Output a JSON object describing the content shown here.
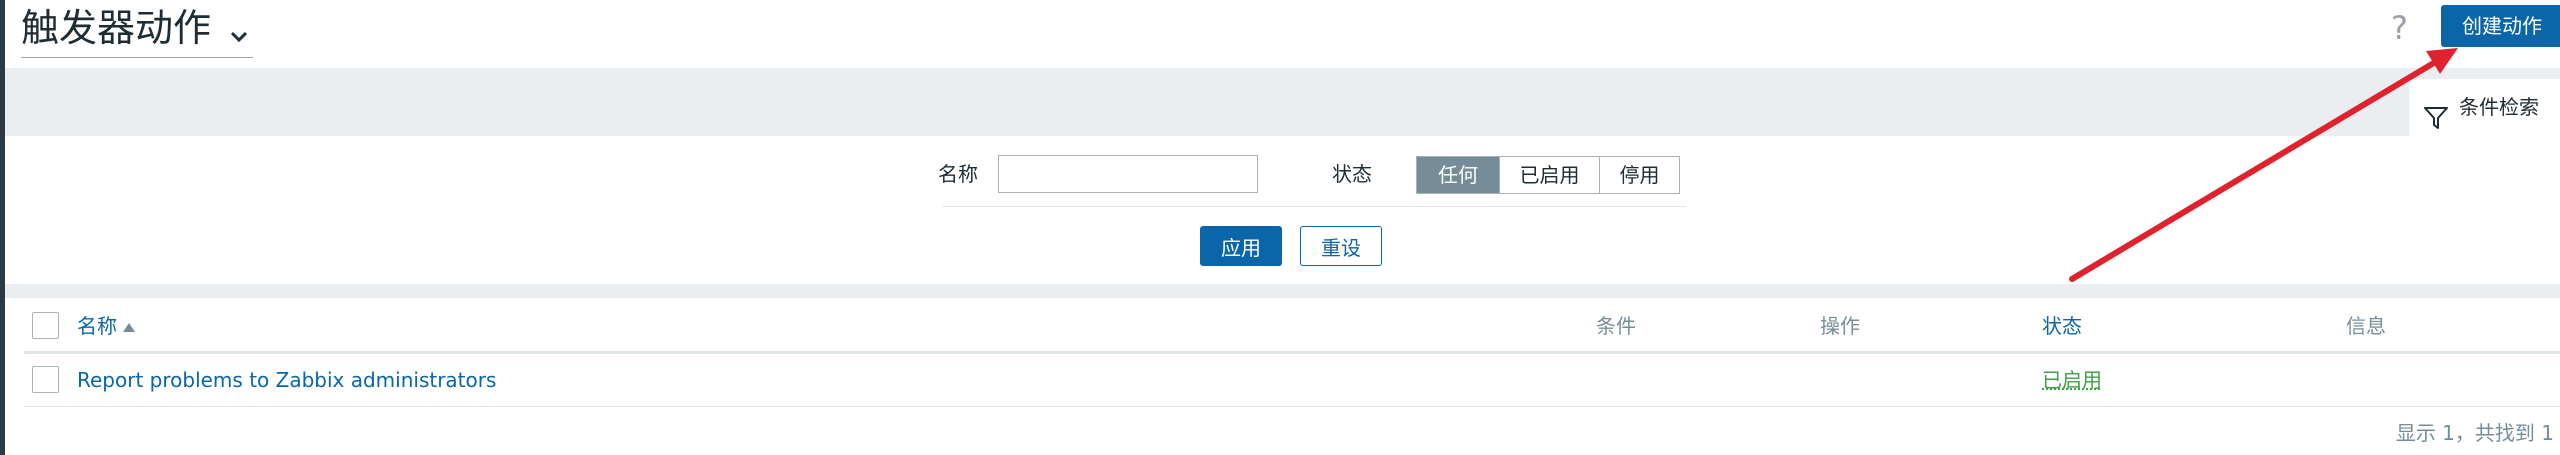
{
  "header": {
    "title": "触发器动作",
    "help_glyph": "?",
    "create_button": "创建动作"
  },
  "filter": {
    "tab_label": "条件检索",
    "name_label": "名称",
    "name_value": "",
    "status_label": "状态",
    "status_options": [
      "任何",
      "已启用",
      "停用"
    ],
    "status_selected": "任何",
    "apply_label": "应用",
    "reset_label": "重设"
  },
  "table": {
    "columns": [
      "名称",
      "条件",
      "操作",
      "状态",
      "信息"
    ],
    "sort_column": "名称",
    "rows": [
      {
        "name": "Report problems to Zabbix administrators",
        "conditions": "",
        "operations": "",
        "status": "已启用",
        "info": ""
      }
    ],
    "footer": "显示 1，共找到 1"
  },
  "colors": {
    "primary": "#0a66a8",
    "status_enabled": "#429e47",
    "annotation_arrow": "#e0212e",
    "segment_active": "#768d99"
  },
  "icons": [
    "chevron-down-icon",
    "help-icon",
    "filter-funnel-icon",
    "sort-ascending-icon"
  ]
}
